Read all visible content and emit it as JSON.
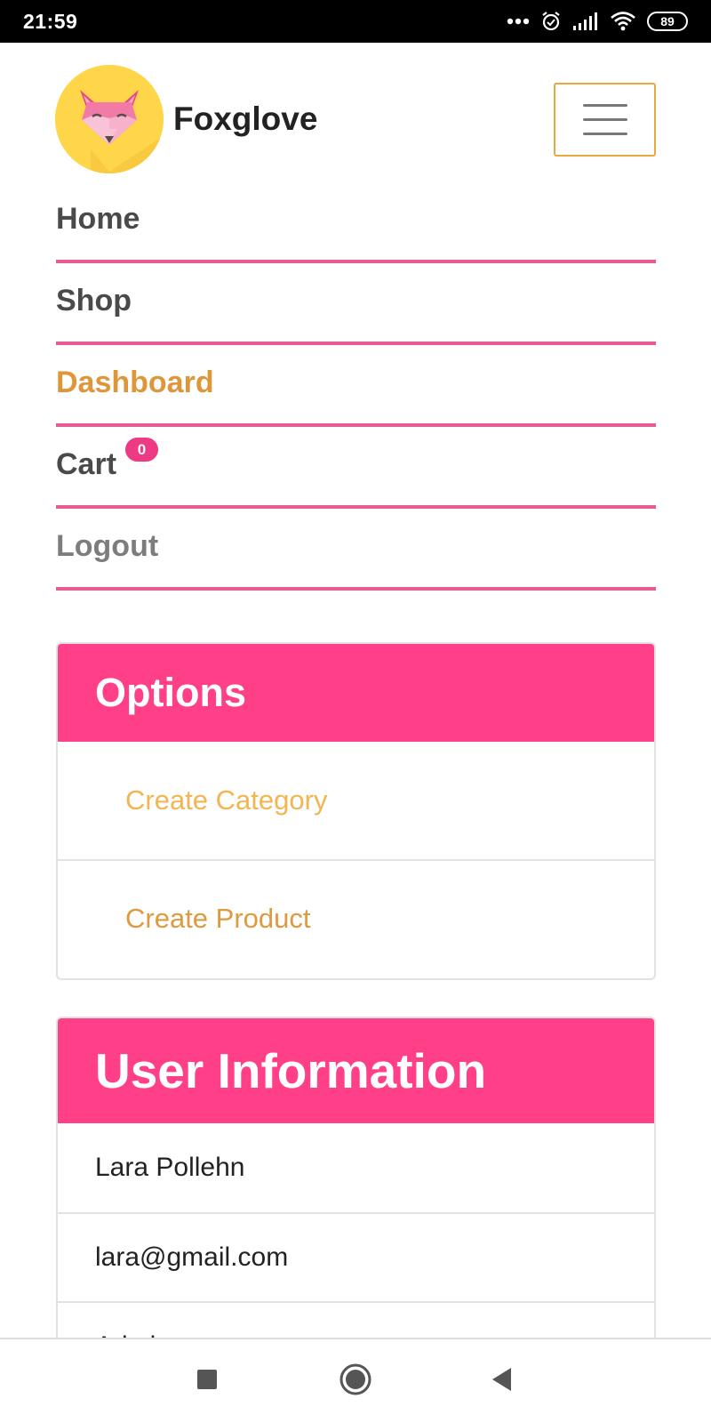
{
  "status_bar": {
    "time": "21:59",
    "battery": "89",
    "icons": [
      "more-dots-icon",
      "alarm-icon",
      "cellular-signal-icon",
      "wifi-icon",
      "battery-icon"
    ]
  },
  "header": {
    "brand": "Foxglove",
    "logo_icon": "fox-logo-icon",
    "menu_icon": "hamburger-menu-icon"
  },
  "nav": {
    "home": "Home",
    "shop": "Shop",
    "dashboard": "Dashboard",
    "cart": "Cart",
    "cart_count": "0",
    "logout": "Logout",
    "active_item": "Dashboard"
  },
  "options_card": {
    "title": "Options",
    "links": [
      "Create Category",
      "Create Product"
    ]
  },
  "user_card": {
    "title": "User Information",
    "name": "Lara Pollehn",
    "email": "lara@gmail.com",
    "role": "Admin"
  },
  "android_nav": {
    "icons": [
      "recent-apps-icon",
      "home-icon",
      "back-icon"
    ]
  },
  "colors": {
    "accent_pink": "#ff3f87",
    "divider_pink": "#e75a92",
    "accent_orange": "#df963a",
    "logo_yellow": "#ffd54a"
  }
}
